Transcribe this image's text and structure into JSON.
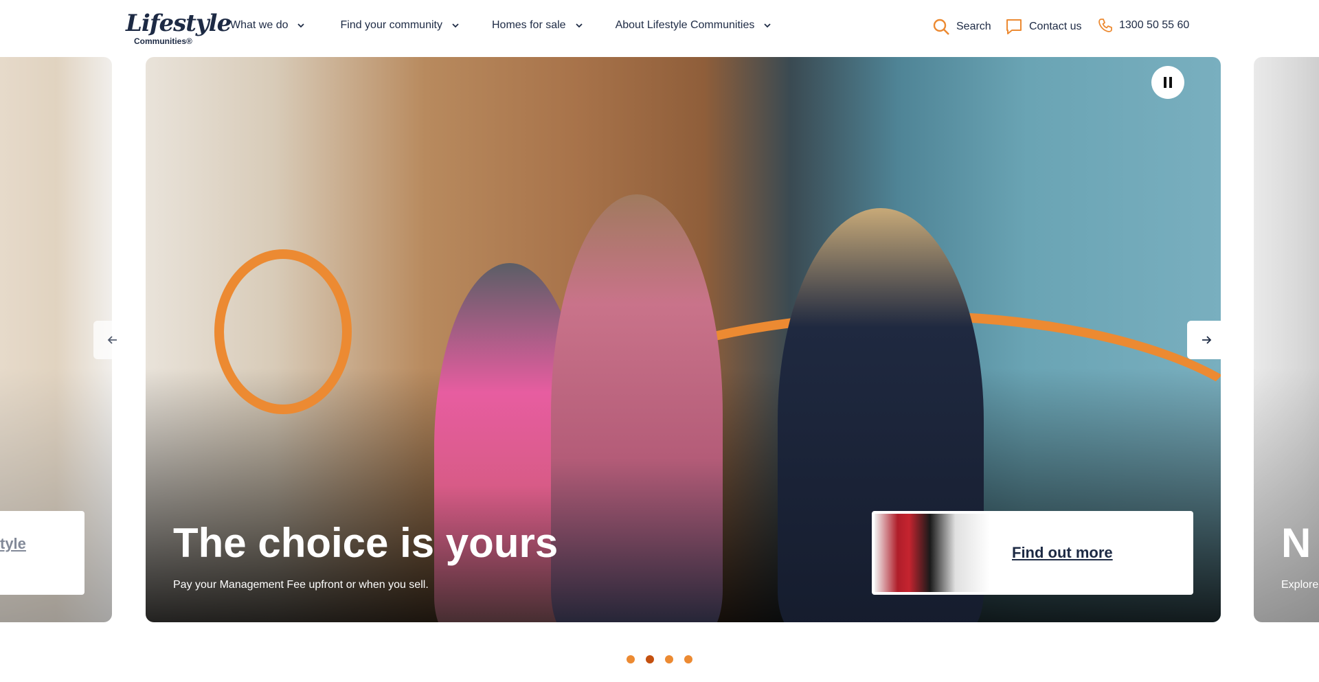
{
  "brand": {
    "logo_text": "Lifestyle",
    "logo_sub": "Communities®",
    "accent": "#ec8a32",
    "navy": "#1d2a44"
  },
  "nav": [
    {
      "label": "What we do"
    },
    {
      "label": "Find your community"
    },
    {
      "label": "Homes for sale"
    },
    {
      "label": "About Lifestyle Communities"
    }
  ],
  "utility": {
    "search": "Search",
    "contact": "Contact us",
    "phone": "1300 50 55 60"
  },
  "carousel": {
    "active": {
      "title": "The choice is yours",
      "subtitle": "Pay your Management Fee upfront or when you sell.",
      "cta": "Find out more",
      "pause_label": "Pause"
    },
    "previous": {
      "cta_fragment": "tyle"
    },
    "next": {
      "title_fragment": "N",
      "subtitle_fragment": "Explore"
    },
    "dots": [
      {
        "active": false
      },
      {
        "active": true
      },
      {
        "active": false
      },
      {
        "active": false
      }
    ]
  }
}
